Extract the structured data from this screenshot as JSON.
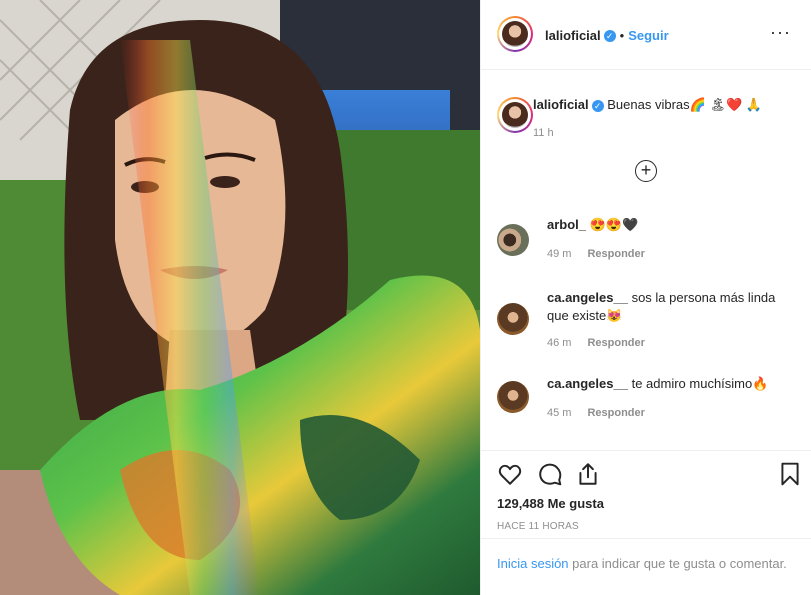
{
  "header": {
    "username": "lalioficial",
    "follow_label": "Seguir",
    "separator": "•",
    "more_label": "···"
  },
  "caption": {
    "username": "lalioficial",
    "text": "Buenas vibras🌈 🏝❤️ 🙏",
    "time": "11 h"
  },
  "load_more_label": "+",
  "comments": [
    {
      "username": "arbol_",
      "text": "😍😍🖤",
      "time": "49 m",
      "reply_label": "Responder"
    },
    {
      "username": "ca.angeles__",
      "text": "sos la persona más linda que existe😻",
      "time": "46 m",
      "reply_label": "Responder"
    },
    {
      "username": "ca.angeles__",
      "text": "te admiro muchísimo🔥",
      "time": "45 m",
      "reply_label": "Responder"
    }
  ],
  "actions": {
    "likes": "129,488 Me gusta",
    "timestamp": "HACE 11 HORAS",
    "icons": [
      "heart-icon",
      "comment-icon",
      "share-icon",
      "bookmark-icon"
    ]
  },
  "login": {
    "link_label": "Inicia sesión",
    "rest_text": " para indicar que te gusta o comentar."
  },
  "colors": {
    "link": "#3897f0",
    "text": "#262626",
    "muted": "#8e8e8e",
    "divider": "#efefef"
  }
}
